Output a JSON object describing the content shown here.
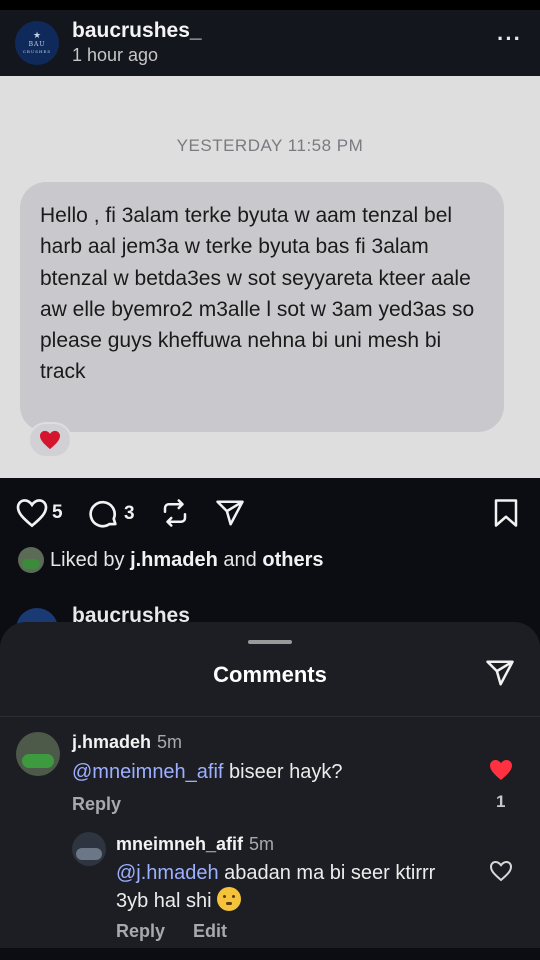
{
  "post": {
    "username": "baucrushes_",
    "time": "1 hour ago",
    "avatar_text": [
      "BAU",
      "CRUSHES"
    ],
    "more_icon": "more-horizontal-icon"
  },
  "screenshot": {
    "timestamp": "YESTERDAY 11:58 PM",
    "message": "Hello , fi 3alam terke byuta w aam tenzal bel harb aal jem3a w terke byuta bas fi 3alam btenzal w betda3es w sot seyyareta kteer aale aw elle byemro2 m3alle l sot w 3am yed3as so please guys kheffuwa nehna bi uni mesh bi track",
    "reaction": "heart-icon"
  },
  "actions": {
    "likes": "5",
    "comments": "3",
    "icons": [
      "heart-icon",
      "comment-icon",
      "repost-icon",
      "share-icon",
      "bookmark-icon"
    ]
  },
  "liked_by": {
    "prefix": "Liked by ",
    "user": "j.hmadeh",
    "middle": " and ",
    "others": "others"
  },
  "next_post": {
    "username": "baucrushes_"
  },
  "comments_sheet": {
    "title": "Comments",
    "comments": [
      {
        "user": "j.hmadeh",
        "time": "5m",
        "mention": "@mneimneh_afif",
        "text": " biseer hayk?",
        "reply_label": "Reply",
        "likes": "1",
        "liked": true
      },
      {
        "user": "mneimneh_afif",
        "time": "5m",
        "mention": "@j.hmadeh",
        "text": " abadan ma bi seer ktirrr 3yb hal shi",
        "reply_label": "Reply",
        "edit_label": "Edit",
        "liked": false
      }
    ]
  },
  "colors": {
    "mention": "#9db0ff",
    "like_red": "#ff3040",
    "background": "#0b0d12",
    "sheet": "#1c1e23"
  }
}
